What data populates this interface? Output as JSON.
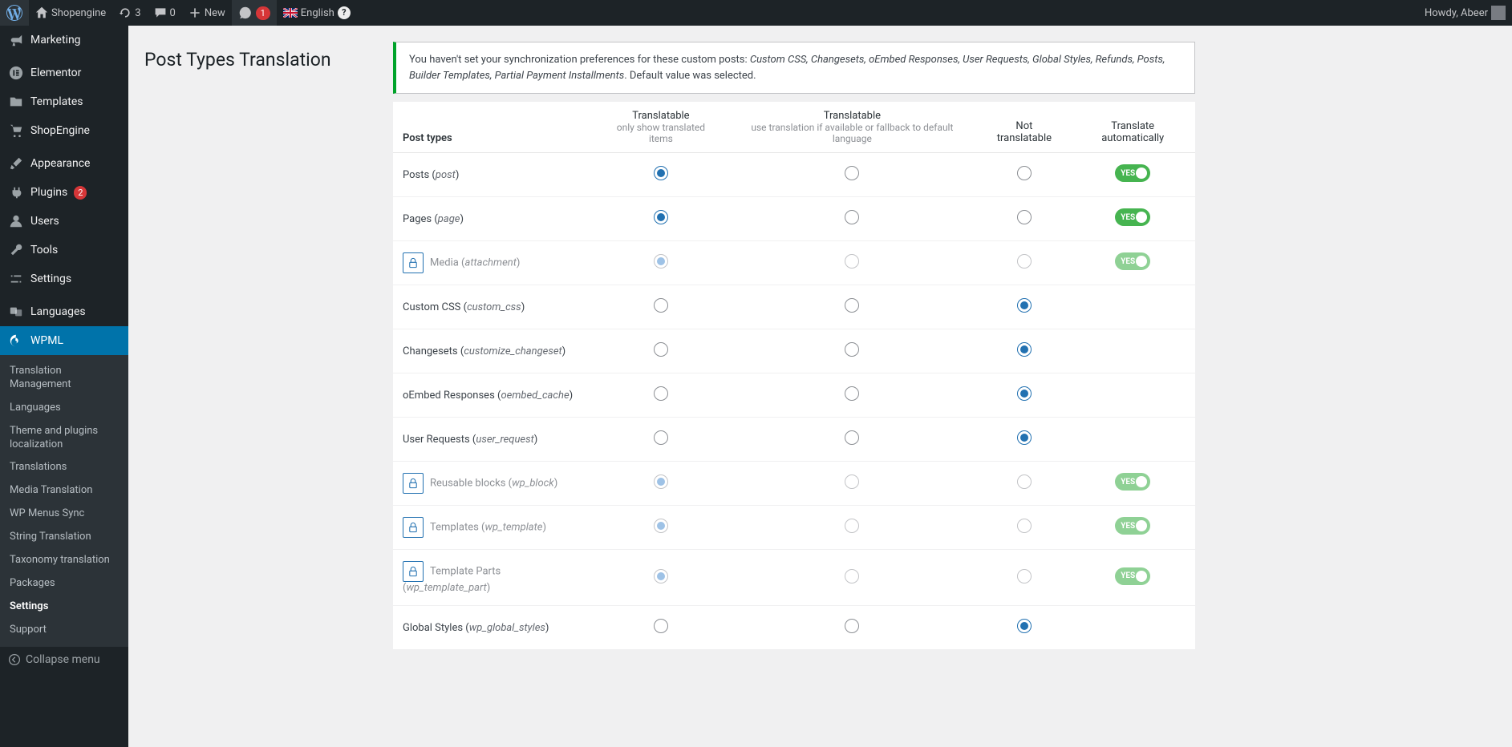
{
  "adminbar": {
    "site_name": "Shopengine",
    "updates_count": "3",
    "comments_count": "0",
    "new_label": "New",
    "notif_count": "1",
    "language": "English",
    "howdy": "Howdy, Abeer"
  },
  "sidebar": {
    "marketing": "Marketing",
    "elementor": "Elementor",
    "templates": "Templates",
    "shopengine": "ShopEngine",
    "appearance": "Appearance",
    "plugins": "Plugins",
    "plugins_count": "2",
    "users": "Users",
    "tools": "Tools",
    "settings": "Settings",
    "languages": "Languages",
    "wpml": "WPML",
    "submenu": {
      "trans_mgmt": "Translation Management",
      "languages": "Languages",
      "theme_loc": "Theme and plugins localization",
      "translations": "Translations",
      "media_trans": "Media Translation",
      "menus_sync": "WP Menus Sync",
      "string_trans": "String Translation",
      "tax_trans": "Taxonomy translation",
      "packages": "Packages",
      "settings": "Settings",
      "support": "Support"
    },
    "collapse": "Collapse menu"
  },
  "page": {
    "title": "Post Types Translation",
    "notice_pre": "You haven't set your synchronization preferences for these custom posts: ",
    "notice_items": "Custom CSS, Changesets, oEmbed Responses, User Requests, Global Styles, Refunds, Posts, Builder Templates, Partial Payment Installments",
    "notice_post": ". Default value was selected."
  },
  "table": {
    "head": {
      "post_types": "Post types",
      "c1_title": "Translatable",
      "c1_sub": "only show translated items",
      "c2_title": "Translatable",
      "c2_sub": "use translation if available or fallback to default language",
      "c3_title": "Not translatable",
      "c4_title": "Translate automatically"
    },
    "toggle_yes": "YES",
    "rows": [
      {
        "label": "Posts",
        "slug": "post",
        "selected": 1,
        "locked": false,
        "toggle": true
      },
      {
        "label": "Pages",
        "slug": "page",
        "selected": 1,
        "locked": false,
        "toggle": true
      },
      {
        "label": "Media",
        "slug": "attachment",
        "selected": 1,
        "locked": true,
        "toggle": true
      },
      {
        "label": "Custom CSS",
        "slug": "custom_css",
        "selected": 3,
        "locked": false,
        "toggle": false
      },
      {
        "label": "Changesets",
        "slug": "customize_changeset",
        "selected": 3,
        "locked": false,
        "toggle": false
      },
      {
        "label": "oEmbed Responses",
        "slug": "oembed_cache",
        "selected": 3,
        "locked": false,
        "toggle": false
      },
      {
        "label": "User Requests",
        "slug": "user_request",
        "selected": 3,
        "locked": false,
        "toggle": false
      },
      {
        "label": "Reusable blocks",
        "slug": "wp_block",
        "selected": 1,
        "locked": true,
        "toggle": true
      },
      {
        "label": "Templates",
        "slug": "wp_template",
        "selected": 1,
        "locked": true,
        "toggle": true
      },
      {
        "label": "Template Parts",
        "slug": "wp_template_part",
        "selected": 1,
        "locked": true,
        "toggle": true
      },
      {
        "label": "Global Styles",
        "slug": "wp_global_styles",
        "selected": 3,
        "locked": false,
        "toggle": false
      }
    ]
  }
}
